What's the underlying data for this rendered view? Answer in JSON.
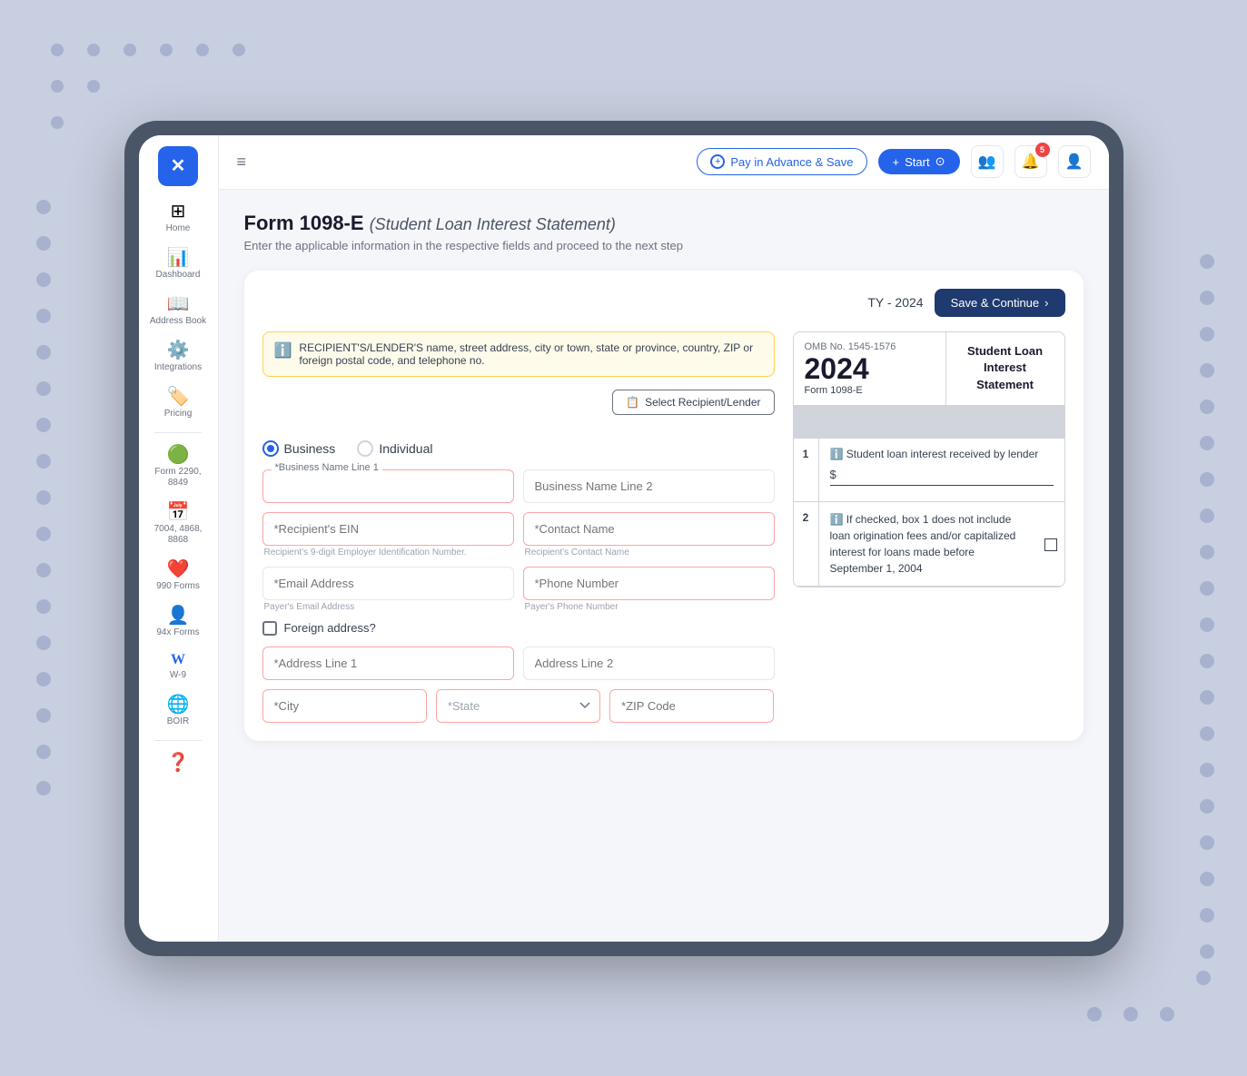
{
  "app": {
    "logo": "✕",
    "logo_bg": "#2563eb"
  },
  "sidebar": {
    "items": [
      {
        "id": "home",
        "icon": "⊞",
        "label": "Home"
      },
      {
        "id": "dashboard",
        "icon": "📊",
        "label": "Dashboard"
      },
      {
        "id": "address-book",
        "icon": "📖",
        "label": "Address Book"
      },
      {
        "id": "integrations",
        "icon": "⚙️",
        "label": "Integrations"
      },
      {
        "id": "pricing",
        "icon": "🏷️",
        "label": "Pricing"
      },
      {
        "id": "form-2290",
        "icon": "🟢",
        "label": "Form 2290, 8849"
      },
      {
        "id": "form-7004",
        "icon": "📅",
        "label": "7004, 4868, 8868"
      },
      {
        "id": "990-forms",
        "icon": "❤️",
        "label": "990 Forms"
      },
      {
        "id": "94x-forms",
        "icon": "👤",
        "label": "94x Forms"
      },
      {
        "id": "w-9",
        "icon": "W",
        "label": "W-9"
      },
      {
        "id": "boir",
        "icon": "🌐",
        "label": "BOIR"
      }
    ]
  },
  "topbar": {
    "pay_advance_label": "Pay in Advance & Save",
    "start_label": "Start",
    "notification_count": "5"
  },
  "page": {
    "title": "Form 1098-E",
    "title_sub": "(Student Loan Interest Statement)",
    "subtitle": "Enter the applicable information in the respective fields and proceed to the next step",
    "ty_label": "TY - 2024",
    "save_continue_label": "Save & Continue"
  },
  "form": {
    "info_text": "RECIPIENT'S/LENDER'S name, street address, city or town, state or province, country, ZIP or foreign postal code, and telephone no.",
    "select_recipient_label": "Select Recipient/Lender",
    "radio_business": "Business",
    "radio_individual": "Individual",
    "selected_radio": "business",
    "fields": {
      "business_name_1": {
        "label": "*Business Name Line 1",
        "placeholder": ""
      },
      "business_name_2": {
        "label": "Business Name Line 2",
        "placeholder": "Business Name Line 2"
      },
      "recipient_ein": {
        "label": "*Recipient's EIN",
        "placeholder": "*Recipient's EIN",
        "hint": "Recipient's 9-digit Employer Identification Number."
      },
      "contact_name": {
        "label": "*Contact Name",
        "placeholder": "*Contact Name",
        "hint": "Recipient's Contact Name"
      },
      "email": {
        "label": "*Email Address",
        "placeholder": "*Email Address",
        "hint": "Payer's Email Address"
      },
      "phone": {
        "label": "*Phone Number",
        "placeholder": "*Phone Number",
        "hint": "Payer's Phone Number"
      },
      "foreign_address": {
        "label": "Foreign address?",
        "checked": false
      },
      "address_line_1": {
        "label": "*Address Line 1",
        "placeholder": "*Address Line 1"
      },
      "address_line_2": {
        "label": "Address Line 2",
        "placeholder": "Address Line 2"
      },
      "city": {
        "label": "*City",
        "placeholder": "*City"
      },
      "state": {
        "label": "*State",
        "placeholder": "*State"
      },
      "zip": {
        "label": "*ZIP Code",
        "placeholder": "*ZIP Code"
      }
    },
    "preview": {
      "omb_label": "OMB No. 1545-1576",
      "year": "2024",
      "form_id": "Form 1098-E",
      "title": "Student Loan Interest Statement",
      "row1_label": "Student loan interest received by lender",
      "row1_num": "1",
      "row2_num": "2",
      "row2_text": "If checked, box 1 does not include loan origination fees and/or capitalized interest for loans made before September 1, 2004"
    }
  }
}
